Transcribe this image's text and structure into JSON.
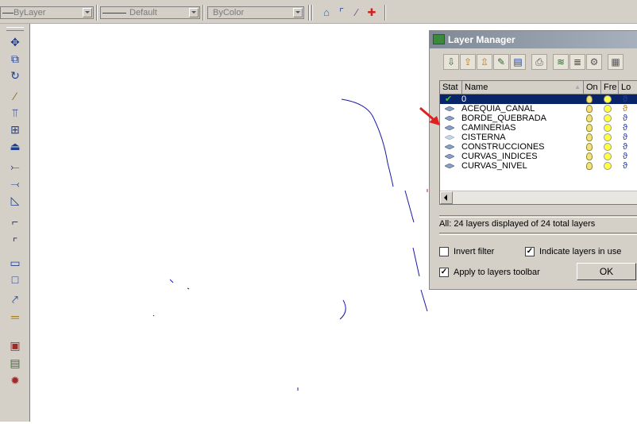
{
  "toolbar": {
    "layer_combo": "ByLayer",
    "linetype_combo": "Default",
    "color_combo": "ByColor"
  },
  "layer_manager": {
    "title": "Layer Manager",
    "columns": {
      "status": "Stat",
      "name": "Name",
      "on": "On",
      "freeze": "Fre",
      "lock": "Lo"
    },
    "layers": [
      {
        "name": "0",
        "selected": true
      },
      {
        "name": "ACEQUIA_CANAL"
      },
      {
        "name": "BORDE_QUEBRADA"
      },
      {
        "name": "CAMINERIAS"
      },
      {
        "name": "CISTERNA"
      },
      {
        "name": "CONSTRUCCIONES"
      },
      {
        "name": "CURVAS_INDICES"
      },
      {
        "name": "CURVAS_NIVEL"
      }
    ],
    "status_text": "All: 24 layers displayed of 24 total layers",
    "invert_filter_label": "Invert filter",
    "indicate_layers_label": "Indicate layers in use",
    "apply_to_toolbar_label": "Apply to layers toolbar",
    "ok_label": "OK",
    "invert_filter_checked": false,
    "indicate_layers_checked": true,
    "apply_to_toolbar_checked": true
  },
  "colors": {
    "selection": "#0a246a",
    "drawing_lines": "#1a1aa8",
    "annotation_arrow": "#e02020"
  }
}
